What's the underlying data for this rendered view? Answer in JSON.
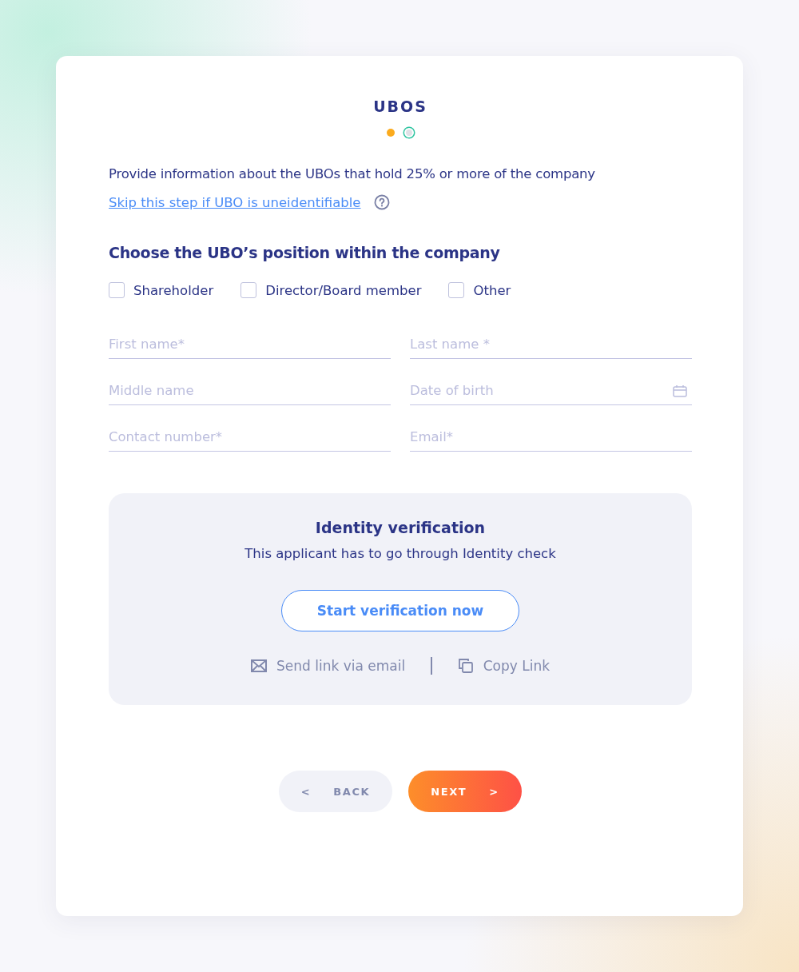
{
  "title": "UBOS",
  "steps": [
    {
      "kind": "current"
    },
    {
      "kind": "pending"
    }
  ],
  "intro": "Provide information about the UBOs that hold 25% or more of the company",
  "skip_link": "Skip this step if UBO is uneidentifiable",
  "position": {
    "heading": "Choose the UBO’s position within the company",
    "options": [
      {
        "label": "Shareholder",
        "checked": false
      },
      {
        "label": "Director/Board member",
        "checked": false
      },
      {
        "label": "Other",
        "checked": false
      }
    ]
  },
  "fields": [
    {
      "placeholder": "First name*",
      "kind": "text"
    },
    {
      "placeholder": "Last name *",
      "kind": "text"
    },
    {
      "placeholder": "Middle name",
      "kind": "text"
    },
    {
      "placeholder": "Date of birth",
      "kind": "date"
    },
    {
      "placeholder": "Contact number*",
      "kind": "text"
    },
    {
      "placeholder": "Email*",
      "kind": "text"
    }
  ],
  "verification": {
    "title": "Identity verification",
    "text": "This applicant has to go through Identity check",
    "button": "Start verification now",
    "send_link": "Send link via email",
    "copy_link": "Copy Link"
  },
  "nav": {
    "back": {
      "label": "BACK",
      "arrow": "<"
    },
    "next": {
      "label": "NEXT",
      "arrow": ">"
    }
  }
}
